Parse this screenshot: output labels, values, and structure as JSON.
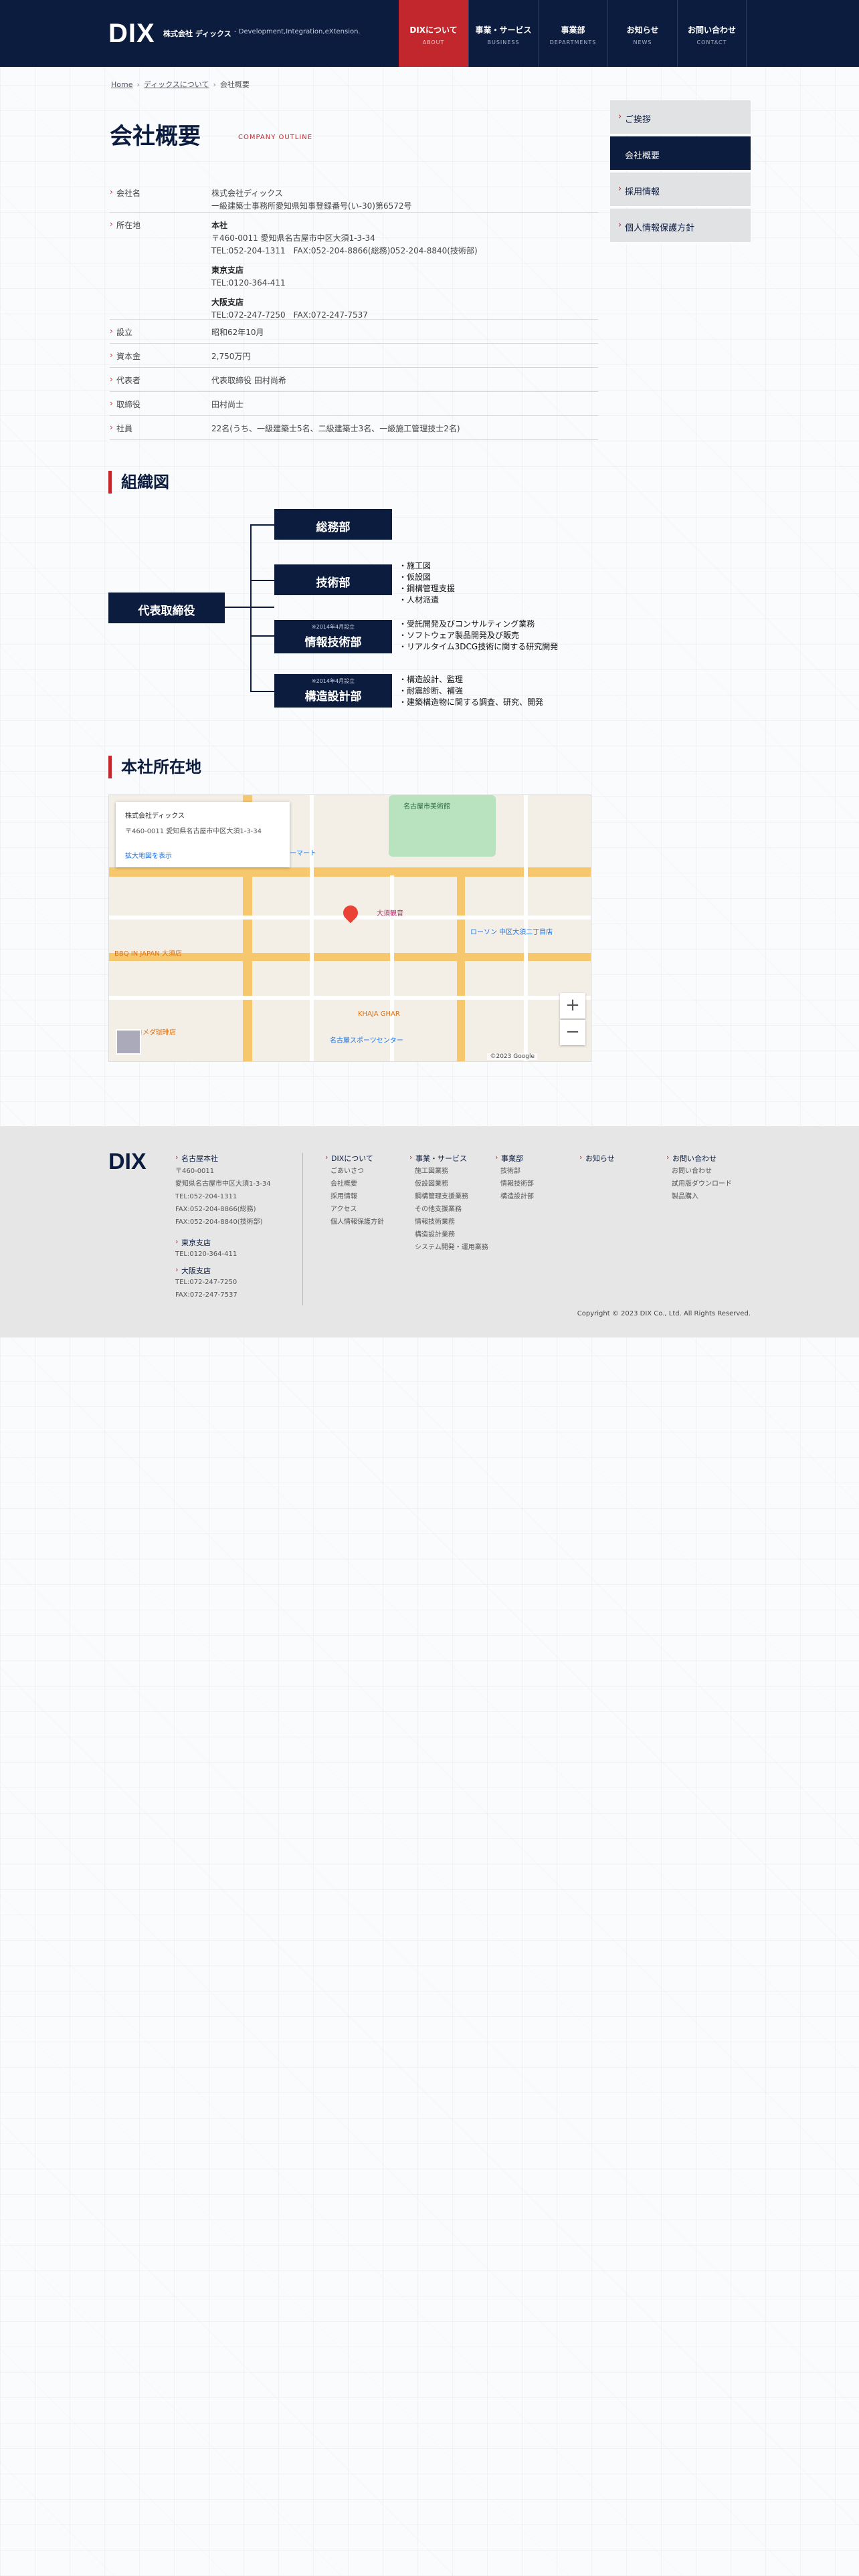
{
  "header": {
    "logo": "DIX",
    "company": "株式会社 ディックス",
    "tagline": "- Development,Integration,eXtension.",
    "nav": [
      {
        "jp": "DIXについて",
        "en": "ABOUT",
        "active": true
      },
      {
        "jp": "事業・サービス",
        "en": "BUSINESS",
        "active": false
      },
      {
        "jp": "事業部",
        "en": "DEPARTMENTS",
        "active": false
      },
      {
        "jp": "お知らせ",
        "en": "NEWS",
        "active": false
      },
      {
        "jp": "お問い合わせ",
        "en": "CONTACT",
        "active": false
      }
    ]
  },
  "breadcrumb": [
    "Home",
    "ディックスについて",
    "会社概要"
  ],
  "page": {
    "title": "会社概要",
    "title_en": "COMPANY OUTLINE"
  },
  "outline": {
    "company_name": {
      "label": "会社名",
      "lines": [
        "株式会社ディックス",
        "一級建築士事務所愛知県知事登録番号(い-30)第6572号"
      ]
    },
    "location": {
      "label": "所在地",
      "head": {
        "name": "本社",
        "lines": [
          "〒460-0011 愛知県名古屋市中区大須1-3-34",
          "TEL:052-204-1311　FAX:052-204-8866(総務)052-204-8840(技術部)"
        ]
      },
      "tokyo": {
        "name": "東京支店",
        "lines": [
          "TEL:0120-364-411"
        ]
      },
      "osaka": {
        "name": "大阪支店",
        "lines": [
          "TEL:072-247-7250　FAX:072-247-7537"
        ]
      }
    },
    "founded": {
      "label": "設立",
      "value": "昭和62年10月"
    },
    "capital": {
      "label": "資本金",
      "value": "2,750万円"
    },
    "representative": {
      "label": "代表者",
      "value": "代表取締役 田村尚希"
    },
    "director": {
      "label": "取締役",
      "value": "田村尚士"
    },
    "employees": {
      "label": "社員",
      "value": "22名(うち、一級建築士5名、二級建築士3名、一級施工管理技士2名)"
    }
  },
  "side_menu": [
    "ご挨拶",
    "会社概要",
    "採用情報",
    "個人情報保護方針"
  ],
  "org": {
    "heading": "組織図",
    "ceo": "代表取締役",
    "depts": [
      {
        "name": "総務部",
        "note": "",
        "duties": []
      },
      {
        "name": "技術部",
        "note": "",
        "duties": [
          "施工図",
          "仮設図",
          "鋼構管理支援",
          "人材派遣"
        ]
      },
      {
        "name": "情報技術部",
        "note": "※2014年4月設立",
        "duties": [
          "受託開発及びコンサルティング業務",
          "ソフトウェア製品開発及び販売",
          "リアルタイム3DCG技術に関する研究開発"
        ]
      },
      {
        "name": "構造設計部",
        "note": "※2014年4月設立",
        "duties": [
          "構造設計、監理",
          "耐震診断、補強",
          "建築構造物に関する調査、研究、開発"
        ]
      }
    ]
  },
  "map": {
    "heading": "本社所在地",
    "card_title": "株式会社ディックス",
    "card_addr": "〒460-0011 愛知県名古屋市中区大須1-3-34",
    "card_link": "拡大地図を表示",
    "labels": [
      "名古屋市美術館",
      "ファミリーマート",
      "大須観音",
      "ローソン 中区大須二丁目店",
      "BBQ IN JAPAN 大須店",
      "コメダ珈琲店",
      "KHAJA GHAR",
      "名古屋スポーツセンター"
    ],
    "zoom_in": "+",
    "zoom_out": "−",
    "credit": "©2023 Google"
  },
  "footer": {
    "logo": "DIX",
    "offices": [
      {
        "name": "名古屋本社",
        "lines": [
          "〒460-0011",
          "愛知県名古屋市中区大須1-3-34",
          "TEL:052-204-1311",
          "FAX:052-204-8866(総務)",
          "FAX:052-204-8840(技術部)"
        ]
      },
      {
        "name": "東京支店",
        "lines": [
          "TEL:0120-364-411"
        ]
      },
      {
        "name": "大阪支店",
        "lines": [
          "TEL:072-247-7250",
          "FAX:072-247-7537"
        ]
      }
    ],
    "cols": [
      {
        "head": "DIXについて",
        "items": [
          "ごあいさつ",
          "会社概要",
          "採用情報",
          "アクセス",
          "個人情報保護方針"
        ]
      },
      {
        "head": "事業・サービス",
        "items": [
          "施工図業務",
          "仮設図業務",
          "鋼構管理支援業務",
          "その他支援業務",
          "情報技術業務",
          "構造設計業務",
          "システム開発・運用業務"
        ]
      },
      {
        "head": "事業部",
        "items": [
          "技術部",
          "情報技術部",
          "構造設計部"
        ]
      },
      {
        "head": "お知らせ",
        "items": []
      },
      {
        "head": "お問い合わせ",
        "items": [
          "お問い合わせ",
          "試用版ダウンロード",
          "製品購入"
        ]
      }
    ],
    "copyright": "Copyright © 2023 DIX Co., Ltd. All Rights Reserved."
  }
}
